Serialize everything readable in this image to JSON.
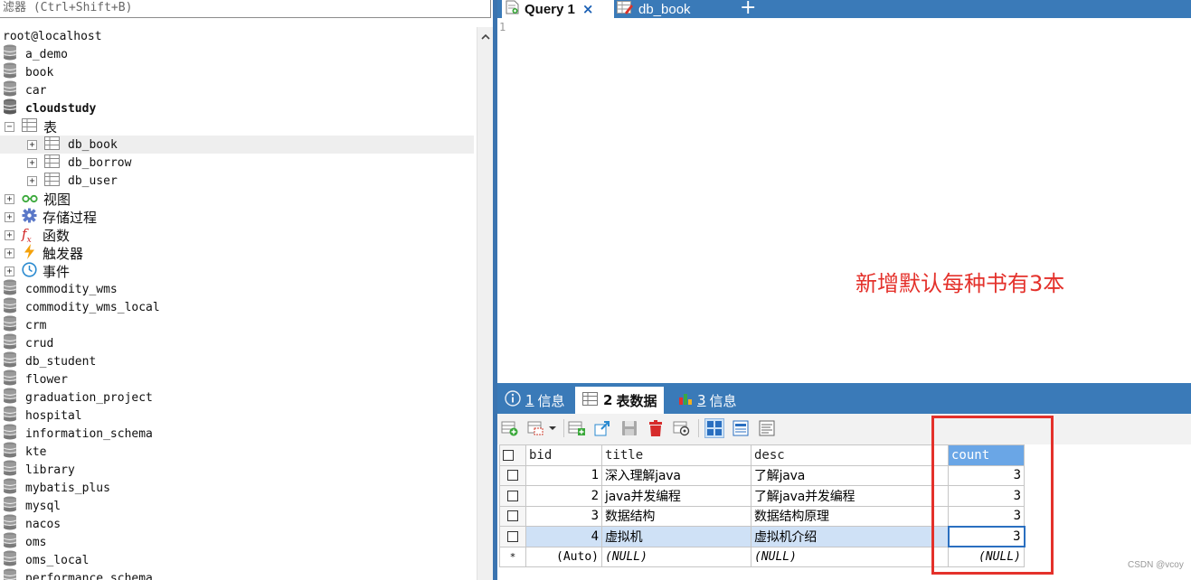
{
  "filter": {
    "placeholder": "滤器 (Ctrl+Shift+B)"
  },
  "tree": {
    "connection": "root@localhost",
    "databases_top": [
      "a_demo",
      "book",
      "car"
    ],
    "open_db": "cloudstudy",
    "tables_folder": "表",
    "tables": [
      "db_book",
      "db_borrow",
      "db_user"
    ],
    "folders": [
      "视图",
      "存储过程",
      "函数",
      "触发器",
      "事件"
    ],
    "databases_rest": [
      "commodity_wms",
      "commodity_wms_local",
      "crm",
      "crud",
      "db_student",
      "flower",
      "graduation_project",
      "hospital",
      "information_schema",
      "kte",
      "library",
      "mybatis_plus",
      "mysql",
      "nacos",
      "oms",
      "oms_local",
      "performance_schema"
    ]
  },
  "query_tabs": {
    "active": "Query 1",
    "close": "×",
    "other": "db_book",
    "add": "+"
  },
  "editor": {
    "line_number": "1",
    "annotation": "新增默认每种书有3本"
  },
  "result_tabs": [
    {
      "num": "1",
      "label": "信息"
    },
    {
      "num": "2",
      "label": "表数据"
    },
    {
      "num": "3",
      "label": "信息"
    }
  ],
  "grid": {
    "columns": [
      "bid",
      "title",
      "desc",
      "count"
    ],
    "rows": [
      [
        "1",
        "深入理解java",
        "了解java",
        "3"
      ],
      [
        "2",
        "java并发编程",
        "了解java并发编程",
        "3"
      ],
      [
        "3",
        "数据结构",
        "数据结构原理",
        "3"
      ],
      [
        "4",
        "虚拟机",
        "虚拟机介绍",
        "3"
      ]
    ],
    "new_row": {
      "marker": "*",
      "bid": "(Auto)",
      "title": "(NULL)",
      "desc": "(NULL)",
      "count": "(NULL)"
    }
  },
  "watermark": "CSDN @vcoy",
  "colors": {
    "accent_blue": "#3a7ab8",
    "highlight_red": "#e4312b",
    "selection": "#cfe1f6"
  }
}
